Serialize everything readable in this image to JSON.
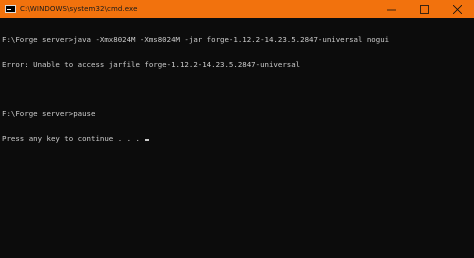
{
  "window": {
    "title": "C:\\WINDOWS\\system32\\cmd.exe",
    "controls": {
      "minimize": "—",
      "maximize": "□",
      "close": "✕"
    }
  },
  "console": {
    "lines": [
      "F:\\Forge server>java -Xmx8024M -Xms8024M -jar forge-1.12.2-14.23.5.2847-universal nogui",
      "Error: Unable to access jarfile forge-1.12.2-14.23.5.2847-universal",
      "",
      "F:\\Forge server>pause",
      "Press any key to continue . . . "
    ]
  },
  "colors": {
    "titlebar": "#f2720d",
    "background": "#0c0c0c",
    "text": "#cccccc"
  }
}
